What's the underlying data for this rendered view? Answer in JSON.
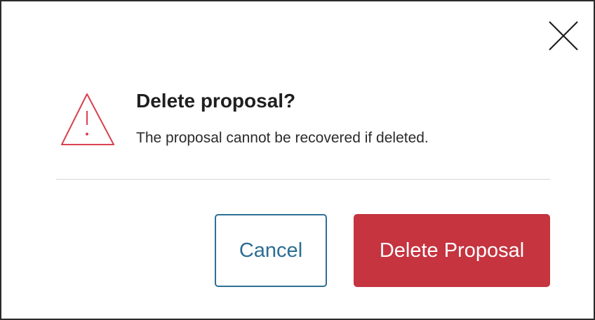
{
  "dialog": {
    "title": "Delete proposal?",
    "message": "The proposal cannot be recovered if deleted.",
    "icon": "warning-triangle-icon",
    "close_icon": "close-icon",
    "cancel_label": "Cancel",
    "delete_label": "Delete Proposal"
  },
  "colors": {
    "danger": "#c5343f",
    "warning_icon": "#d9424f",
    "cancel_text": "#2b6d93",
    "cancel_border": "#2f6f95"
  }
}
